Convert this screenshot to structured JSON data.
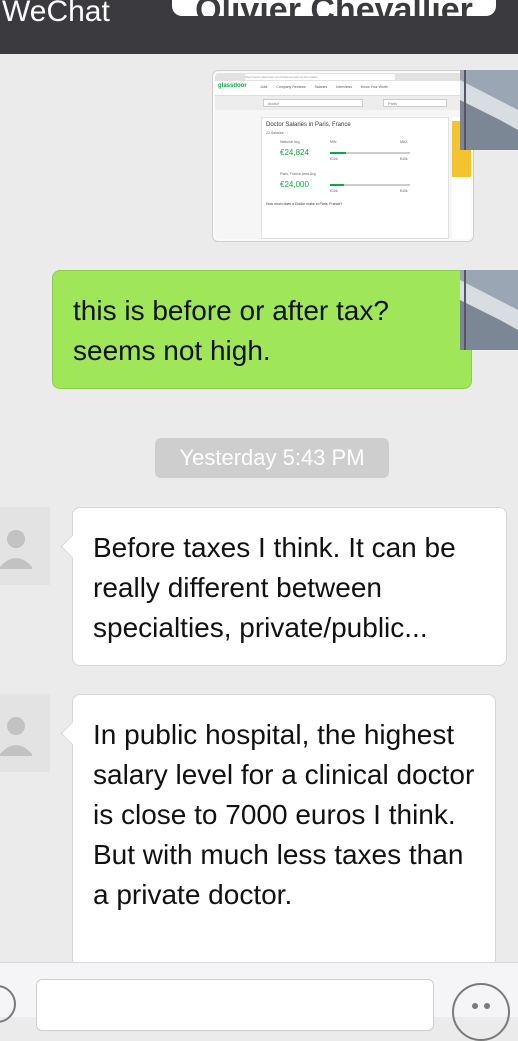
{
  "header": {
    "back_label": "WeChat",
    "title": "Olivier Chevallier"
  },
  "messages": [
    {
      "sender": "me",
      "type": "image",
      "screenshot": {
        "site": "glassdoor",
        "url": "https://www.glassdoor.com/Salaries/paris-doctor-salary",
        "nav_tabs": [
          "Jobs",
          "Company Reviews",
          "Salaries",
          "Interviews",
          "Know Your Worth"
        ],
        "search_query": "doctor",
        "search_location": "Paris",
        "card_title": "Doctor Salaries in Paris, France",
        "national_label": "National Avg",
        "national_value": "€24,824",
        "area_label": "Paris, France Area Avg",
        "area_value": "€24,000",
        "salaries_count": "23 Salaries",
        "question": "How much does a Doctor make in Paris, France?",
        "min_label": "MIN",
        "max_label": "MAX",
        "min_national": "€10k",
        "max_national": "€40k",
        "min_area": "€10k",
        "max_area": "€40k"
      }
    },
    {
      "sender": "me",
      "type": "text",
      "text": "this is before or after tax? seems not high."
    },
    {
      "type": "timestamp",
      "text": "Yesterday 5:43 PM"
    },
    {
      "sender": "other",
      "type": "text",
      "text": "Before taxes I think. It can be really different between specialties, private/public..."
    },
    {
      "sender": "other",
      "type": "text",
      "text": "In public hospital, the highest salary level for a clinical doctor is close to 7000 euros I think. But with much less taxes than a private doctor."
    }
  ],
  "input": {
    "placeholder": ""
  },
  "colors": {
    "topbar": "#3a3a3f",
    "sent_bubble": "#9fe658",
    "received_bubble": "#ffffff",
    "background": "#ebebeb"
  }
}
